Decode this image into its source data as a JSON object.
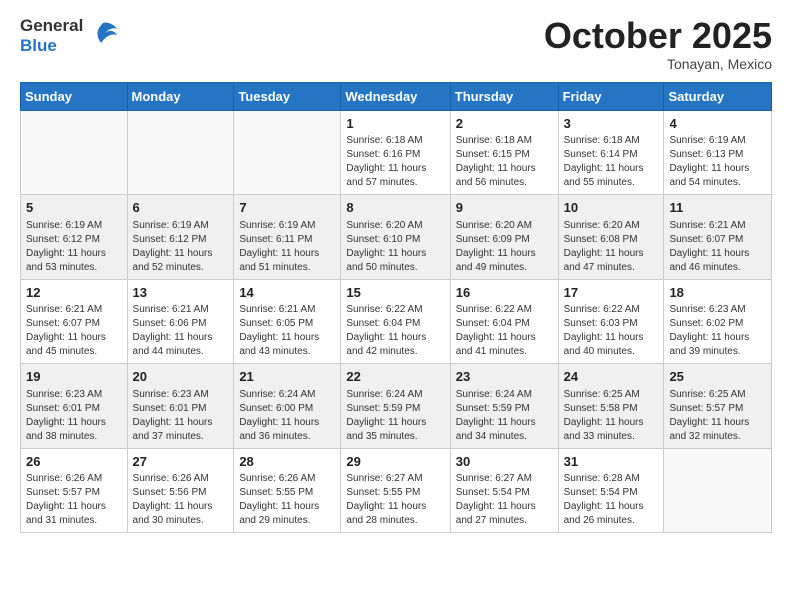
{
  "logo": {
    "line1": "General",
    "line2": "Blue"
  },
  "header": {
    "month": "October 2025",
    "location": "Tonayan, Mexico"
  },
  "weekdays": [
    "Sunday",
    "Monday",
    "Tuesday",
    "Wednesday",
    "Thursday",
    "Friday",
    "Saturday"
  ],
  "weeks": [
    [
      {
        "day": "",
        "info": ""
      },
      {
        "day": "",
        "info": ""
      },
      {
        "day": "",
        "info": ""
      },
      {
        "day": "1",
        "info": "Sunrise: 6:18 AM\nSunset: 6:16 PM\nDaylight: 11 hours\nand 57 minutes."
      },
      {
        "day": "2",
        "info": "Sunrise: 6:18 AM\nSunset: 6:15 PM\nDaylight: 11 hours\nand 56 minutes."
      },
      {
        "day": "3",
        "info": "Sunrise: 6:18 AM\nSunset: 6:14 PM\nDaylight: 11 hours\nand 55 minutes."
      },
      {
        "day": "4",
        "info": "Sunrise: 6:19 AM\nSunset: 6:13 PM\nDaylight: 11 hours\nand 54 minutes."
      }
    ],
    [
      {
        "day": "5",
        "info": "Sunrise: 6:19 AM\nSunset: 6:12 PM\nDaylight: 11 hours\nand 53 minutes."
      },
      {
        "day": "6",
        "info": "Sunrise: 6:19 AM\nSunset: 6:12 PM\nDaylight: 11 hours\nand 52 minutes."
      },
      {
        "day": "7",
        "info": "Sunrise: 6:19 AM\nSunset: 6:11 PM\nDaylight: 11 hours\nand 51 minutes."
      },
      {
        "day": "8",
        "info": "Sunrise: 6:20 AM\nSunset: 6:10 PM\nDaylight: 11 hours\nand 50 minutes."
      },
      {
        "day": "9",
        "info": "Sunrise: 6:20 AM\nSunset: 6:09 PM\nDaylight: 11 hours\nand 49 minutes."
      },
      {
        "day": "10",
        "info": "Sunrise: 6:20 AM\nSunset: 6:08 PM\nDaylight: 11 hours\nand 47 minutes."
      },
      {
        "day": "11",
        "info": "Sunrise: 6:21 AM\nSunset: 6:07 PM\nDaylight: 11 hours\nand 46 minutes."
      }
    ],
    [
      {
        "day": "12",
        "info": "Sunrise: 6:21 AM\nSunset: 6:07 PM\nDaylight: 11 hours\nand 45 minutes."
      },
      {
        "day": "13",
        "info": "Sunrise: 6:21 AM\nSunset: 6:06 PM\nDaylight: 11 hours\nand 44 minutes."
      },
      {
        "day": "14",
        "info": "Sunrise: 6:21 AM\nSunset: 6:05 PM\nDaylight: 11 hours\nand 43 minutes."
      },
      {
        "day": "15",
        "info": "Sunrise: 6:22 AM\nSunset: 6:04 PM\nDaylight: 11 hours\nand 42 minutes."
      },
      {
        "day": "16",
        "info": "Sunrise: 6:22 AM\nSunset: 6:04 PM\nDaylight: 11 hours\nand 41 minutes."
      },
      {
        "day": "17",
        "info": "Sunrise: 6:22 AM\nSunset: 6:03 PM\nDaylight: 11 hours\nand 40 minutes."
      },
      {
        "day": "18",
        "info": "Sunrise: 6:23 AM\nSunset: 6:02 PM\nDaylight: 11 hours\nand 39 minutes."
      }
    ],
    [
      {
        "day": "19",
        "info": "Sunrise: 6:23 AM\nSunset: 6:01 PM\nDaylight: 11 hours\nand 38 minutes."
      },
      {
        "day": "20",
        "info": "Sunrise: 6:23 AM\nSunset: 6:01 PM\nDaylight: 11 hours\nand 37 minutes."
      },
      {
        "day": "21",
        "info": "Sunrise: 6:24 AM\nSunset: 6:00 PM\nDaylight: 11 hours\nand 36 minutes."
      },
      {
        "day": "22",
        "info": "Sunrise: 6:24 AM\nSunset: 5:59 PM\nDaylight: 11 hours\nand 35 minutes."
      },
      {
        "day": "23",
        "info": "Sunrise: 6:24 AM\nSunset: 5:59 PM\nDaylight: 11 hours\nand 34 minutes."
      },
      {
        "day": "24",
        "info": "Sunrise: 6:25 AM\nSunset: 5:58 PM\nDaylight: 11 hours\nand 33 minutes."
      },
      {
        "day": "25",
        "info": "Sunrise: 6:25 AM\nSunset: 5:57 PM\nDaylight: 11 hours\nand 32 minutes."
      }
    ],
    [
      {
        "day": "26",
        "info": "Sunrise: 6:26 AM\nSunset: 5:57 PM\nDaylight: 11 hours\nand 31 minutes."
      },
      {
        "day": "27",
        "info": "Sunrise: 6:26 AM\nSunset: 5:56 PM\nDaylight: 11 hours\nand 30 minutes."
      },
      {
        "day": "28",
        "info": "Sunrise: 6:26 AM\nSunset: 5:55 PM\nDaylight: 11 hours\nand 29 minutes."
      },
      {
        "day": "29",
        "info": "Sunrise: 6:27 AM\nSunset: 5:55 PM\nDaylight: 11 hours\nand 28 minutes."
      },
      {
        "day": "30",
        "info": "Sunrise: 6:27 AM\nSunset: 5:54 PM\nDaylight: 11 hours\nand 27 minutes."
      },
      {
        "day": "31",
        "info": "Sunrise: 6:28 AM\nSunset: 5:54 PM\nDaylight: 11 hours\nand 26 minutes."
      },
      {
        "day": "",
        "info": ""
      }
    ]
  ]
}
